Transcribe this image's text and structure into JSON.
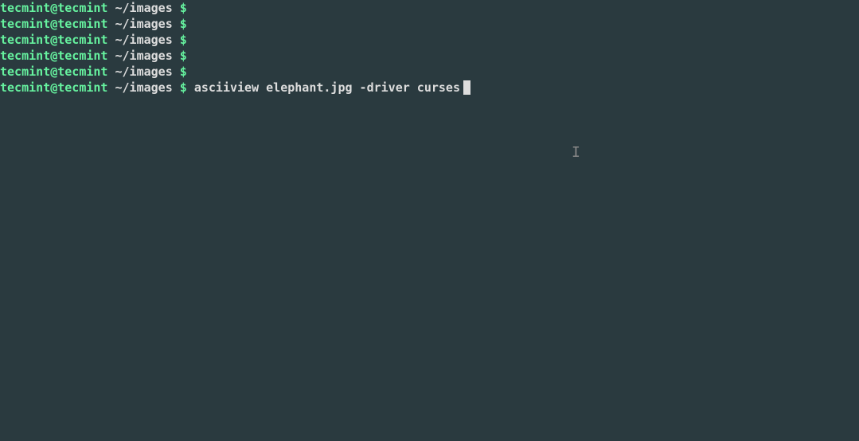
{
  "prompt": {
    "userhost": "tecmint@tecmint",
    "path": " ~/images ",
    "symbol": "$"
  },
  "lines": [
    {
      "command": ""
    },
    {
      "command": ""
    },
    {
      "command": ""
    },
    {
      "command": ""
    },
    {
      "command": ""
    },
    {
      "command": " asciiview elephant.jpg -driver curses",
      "cursor": true
    }
  ],
  "ibeam": "I"
}
